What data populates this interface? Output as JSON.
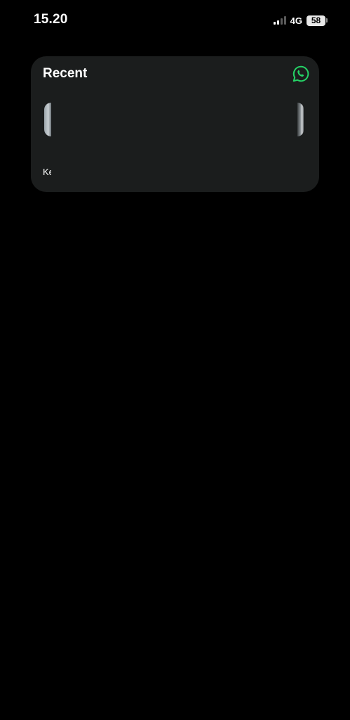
{
  "status_bar": {
    "time": "15.20",
    "network": "4G",
    "battery_level": "58",
    "signal_bars_active": 2,
    "signal_bars_total": 4
  },
  "widget": {
    "title": "Recent",
    "app_icon": "whatsapp-icon",
    "accent_color": "#25D366",
    "contacts": [
      {
        "name": "Ke"
      }
    ]
  }
}
